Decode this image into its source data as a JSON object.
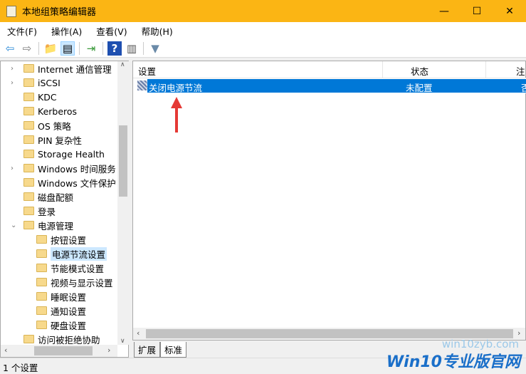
{
  "window": {
    "title": "本地组策略编辑器",
    "minimize": "—",
    "maximize": "☐",
    "close": "✕"
  },
  "menu": [
    "文件(F)",
    "操作(A)",
    "查看(V)",
    "帮助(H)"
  ],
  "toolbar": [
    {
      "icon": "back-icon",
      "glyph": "⇦"
    },
    {
      "icon": "forward-icon",
      "glyph": "⇨"
    },
    {
      "icon": "up-folder-icon",
      "glyph": "📁"
    },
    {
      "icon": "show-hide-tree-icon",
      "glyph": "▤"
    },
    {
      "icon": "export-list-icon",
      "glyph": "⇥"
    },
    {
      "icon": "help-icon",
      "glyph": "?"
    },
    {
      "icon": "extended-view-icon",
      "glyph": "▥"
    },
    {
      "icon": "filter-icon",
      "glyph": "▼"
    }
  ],
  "tree": [
    {
      "label": "Internet 通信管理",
      "level": 1,
      "expandable": true
    },
    {
      "label": "iSCSI",
      "level": 1,
      "expandable": true
    },
    {
      "label": "KDC",
      "level": 1
    },
    {
      "label": "Kerberos",
      "level": 1
    },
    {
      "label": "OS 策略",
      "level": 1
    },
    {
      "label": "PIN 复杂性",
      "level": 1
    },
    {
      "label": "Storage Health",
      "level": 1
    },
    {
      "label": "Windows 时间服务",
      "level": 1,
      "expandable": true
    },
    {
      "label": "Windows 文件保护",
      "level": 1
    },
    {
      "label": "磁盘配额",
      "level": 1
    },
    {
      "label": "登录",
      "level": 1
    },
    {
      "label": "电源管理",
      "level": 1,
      "expanded": true
    },
    {
      "label": "按钮设置",
      "level": 2
    },
    {
      "label": "电源节流设置",
      "level": 2,
      "selected": true
    },
    {
      "label": "节能模式设置",
      "level": 2
    },
    {
      "label": "视频与显示设置",
      "level": 2
    },
    {
      "label": "睡眠设置",
      "level": 2
    },
    {
      "label": "通知设置",
      "level": 2
    },
    {
      "label": "硬盘设置",
      "level": 2
    },
    {
      "label": "访问被拒绝协助",
      "level": 1
    }
  ],
  "list": {
    "headers": [
      "设置",
      "状态",
      "注"
    ],
    "rows": [
      {
        "setting": "关闭电源节流",
        "state": "未配置",
        "comment": "否"
      }
    ]
  },
  "tabs": [
    "扩展",
    "标准"
  ],
  "status": "1 个设置",
  "watermark": {
    "main": "Win10专业版官网",
    "url": "win10zyb.com"
  },
  "colors": {
    "titlebar": "#fbb514",
    "selection": "#0078d7",
    "arrow": "#e53935"
  }
}
